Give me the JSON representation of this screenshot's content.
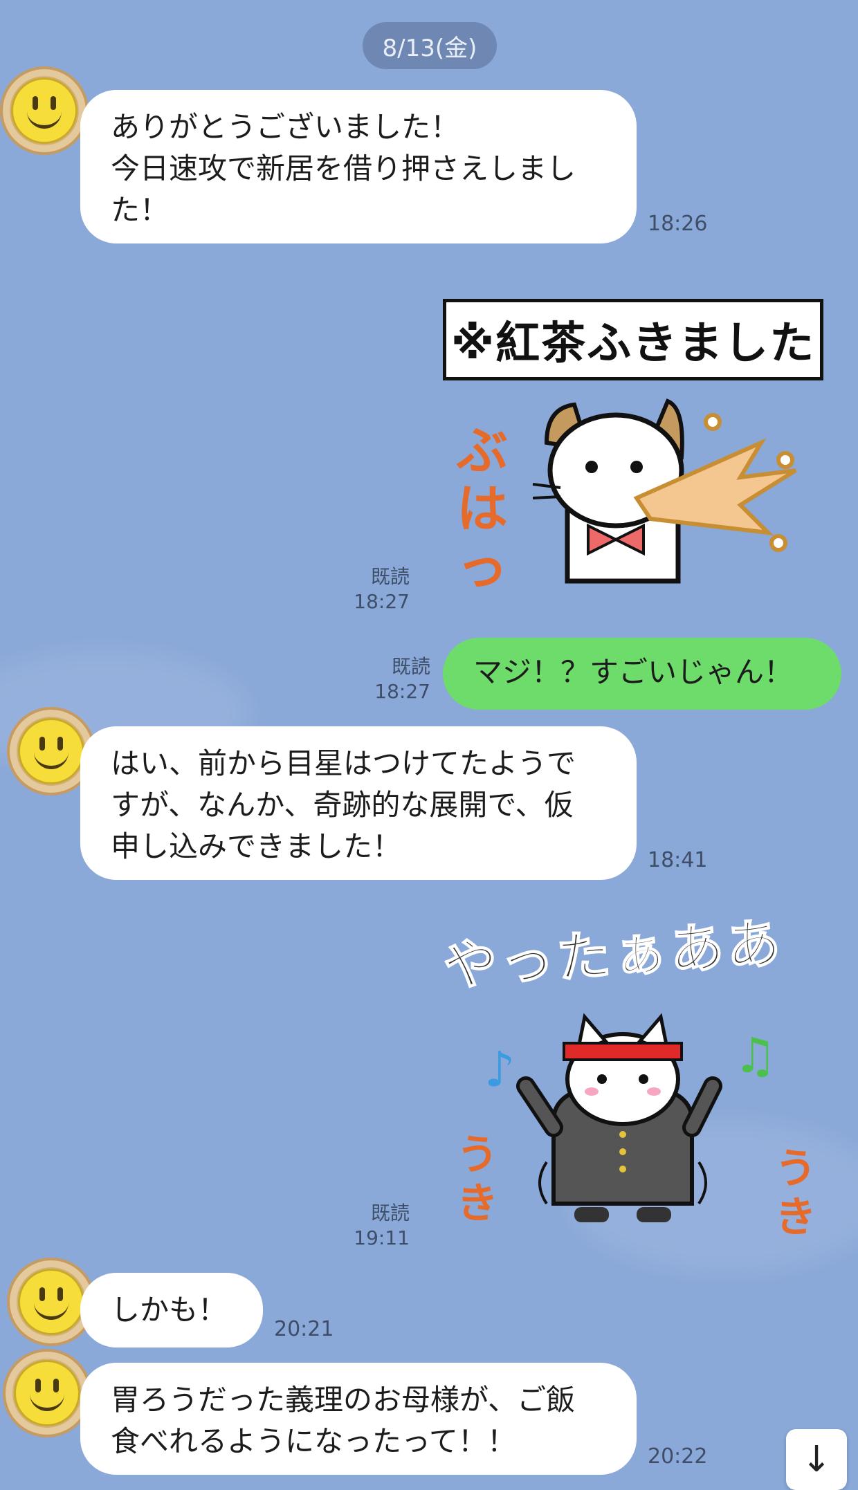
{
  "date_separator": "8/13(金)",
  "messages": [
    {
      "side": "left",
      "text": "ありがとうございました！\n今日速攻で新居を借り押さえしまし\nた！",
      "time": "18:26"
    },
    {
      "side": "right",
      "type": "sticker",
      "sticker_text": "※紅茶ふきました",
      "sfx": "ぶはっ",
      "read": "既読",
      "time": "18:27"
    },
    {
      "side": "right",
      "text": "マジ！？すごいじゃん！",
      "read": "既読",
      "time": "18:27"
    },
    {
      "side": "left",
      "text": "はい、前から目星はつけてたようで\nすが、なんか、奇跡的な展開で、仮\n申し込みできました！",
      "time": "18:41"
    },
    {
      "side": "right",
      "type": "sticker",
      "sticker_text": "やったぁああ",
      "sfx_left": "うき",
      "sfx_right": "うき",
      "read": "既読",
      "time": "19:11"
    },
    {
      "side": "left",
      "text": "しかも！",
      "time": "20:21"
    },
    {
      "side": "left",
      "text": "胃ろうだった義理のお母様が、ご飯\n食べれるようになったって！！",
      "time": "20:22"
    }
  ],
  "scroll_button_icon": "arrow-down-icon",
  "colors": {
    "background": "#8aa8d8",
    "bubble_left": "#ffffff",
    "bubble_right": "#6edc6a",
    "date_pill": "#6f88b3"
  }
}
